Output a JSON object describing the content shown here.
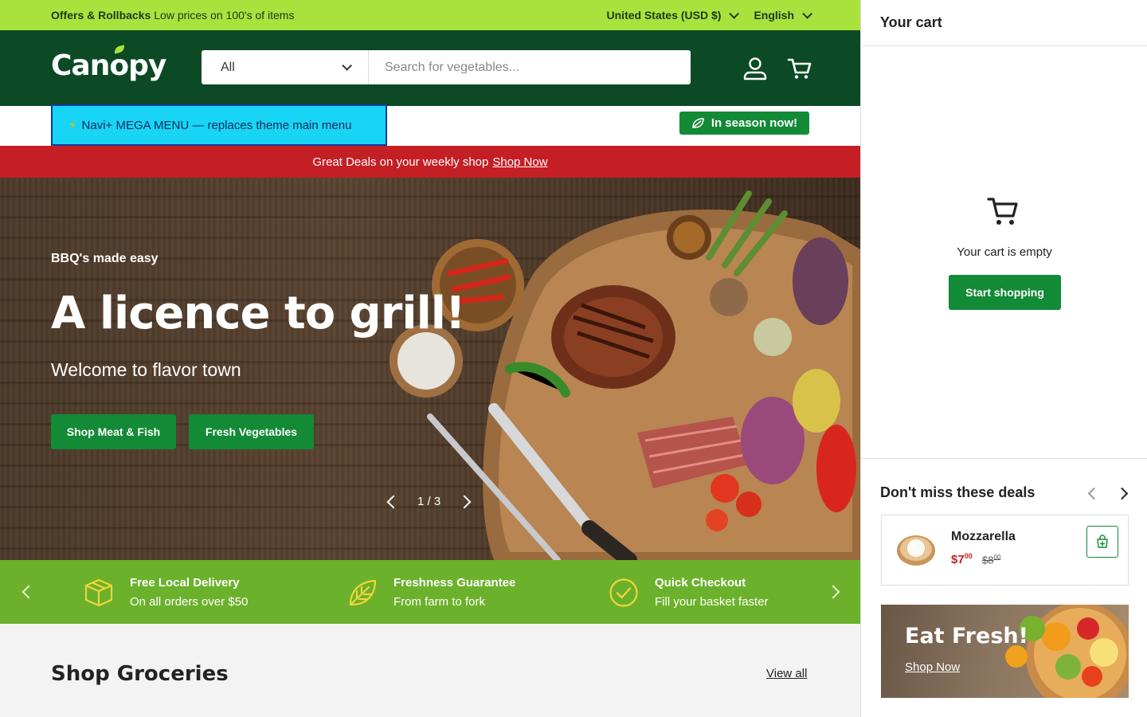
{
  "announcement": {
    "offer_strong": "Offers & Rollbacks",
    "offer_text": "Low prices on 100's of items",
    "country": "United States (USD $)",
    "language": "English"
  },
  "header": {
    "logo": "Canopy",
    "search_category": "All",
    "search_placeholder": "Search for vegetables..."
  },
  "nav": {
    "mega_menu_icon": "⚡",
    "mega_menu": "Navi+ MEGA MENU — replaces theme main menu",
    "season_badge": "In season now!"
  },
  "deals_bar": {
    "text": "Great Deals on your weekly shop",
    "link": "Shop Now"
  },
  "hero": {
    "eyebrow": "BBQ's made easy",
    "title": "A licence to grill!",
    "subtitle": "Welcome to flavor town",
    "buttons": [
      "Shop Meat & Fish",
      "Fresh Vegetables"
    ],
    "slide_counter": "1 / 3"
  },
  "features": [
    {
      "title": "Free Local Delivery",
      "subtitle": "On all orders over $50",
      "icon": "box-icon"
    },
    {
      "title": "Freshness Guarantee",
      "subtitle": "From farm to fork",
      "icon": "leaf-icon"
    },
    {
      "title": "Quick Checkout",
      "subtitle": "Fill your basket faster",
      "icon": "check-circle-icon"
    }
  ],
  "groceries": {
    "title": "Shop Groceries",
    "view_all": "View all"
  },
  "cart": {
    "title": "Your cart",
    "empty_message": "Your cart is empty",
    "start_shopping": "Start shopping",
    "deals_title": "Don't miss these deals",
    "deal": {
      "name": "Mozzarella",
      "price_whole": "$7",
      "price_cents": "00",
      "was_whole": "$8",
      "was_cents": "00"
    },
    "promo_title": "Eat Fresh!",
    "promo_link": "Shop Now"
  },
  "colors": {
    "announce_bg": "#a9e23c",
    "header_bg": "#0b4a24",
    "button_green": "#138a36",
    "deals_red": "#c41f24",
    "features_bg": "#6bb12b",
    "mega_menu_bg": "#18d4f5"
  }
}
